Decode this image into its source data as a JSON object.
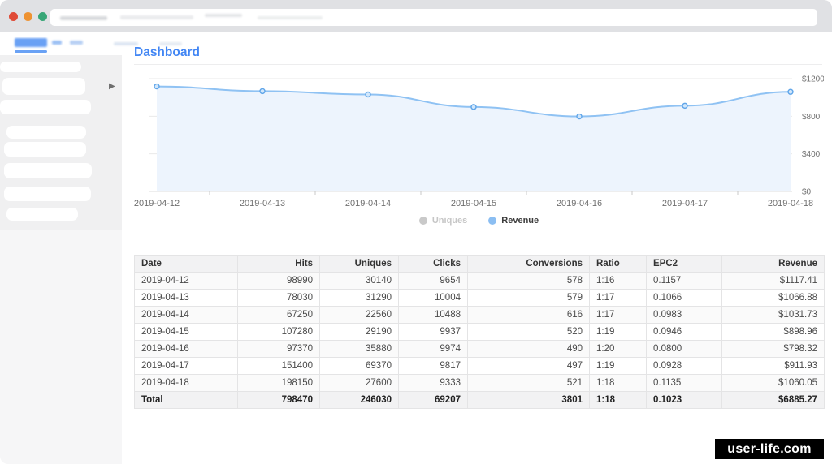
{
  "page": {
    "title": "Dashboard",
    "watermark": "user-life.com"
  },
  "browser": {
    "buttons": [
      "close",
      "minimize",
      "zoom"
    ],
    "url_text": "(redacted)"
  },
  "sidebar": {
    "items_redacted": 8,
    "expander_icon": "chevron-right-icon"
  },
  "colors": {
    "accent_blue": "#4286f4",
    "chart_line": "#8fc2f3",
    "chart_fill": "#edf4fd",
    "chart_point": "#5fa5e9"
  },
  "chart_data": {
    "type": "area",
    "title": "",
    "x": [
      "2019-04-12",
      "2019-04-13",
      "2019-04-14",
      "2019-04-15",
      "2019-04-16",
      "2019-04-17",
      "2019-04-18"
    ],
    "series": [
      {
        "name": "Revenue",
        "values": [
          1117.41,
          1066.88,
          1031.73,
          898.96,
          798.32,
          911.93,
          1060.05
        ]
      }
    ],
    "ylim": [
      0,
      1200
    ],
    "ytick_values": [
      0,
      400,
      800,
      1200
    ],
    "yticks": [
      "$0",
      "$400",
      "$800",
      "$1200"
    ],
    "legend_position": "bottom",
    "grid": true,
    "legend": [
      {
        "label": "Uniques",
        "color": "#c9c9c9",
        "active": false
      },
      {
        "label": "Revenue",
        "color": "#8bbef2",
        "active": true
      }
    ]
  },
  "table": {
    "columns": [
      {
        "label": "Date",
        "align": "left",
        "width": 127
      },
      {
        "label": "Hits",
        "align": "right",
        "width": 101
      },
      {
        "label": "Uniques",
        "align": "right",
        "width": 97
      },
      {
        "label": "Clicks",
        "align": "right",
        "width": 85
      },
      {
        "label": "Conversions",
        "align": "right",
        "width": 150
      },
      {
        "label": "Ratio",
        "align": "left",
        "width": 70
      },
      {
        "label": "EPC2",
        "align": "left",
        "width": 93
      },
      {
        "label": "Revenue",
        "align": "right",
        "width": 126
      }
    ],
    "rows": [
      [
        "2019-04-12",
        "98990",
        "30140",
        "9654",
        "578",
        "1:16",
        "0.1157",
        "$1117.41"
      ],
      [
        "2019-04-13",
        "78030",
        "31290",
        "10004",
        "579",
        "1:17",
        "0.1066",
        "$1066.88"
      ],
      [
        "2019-04-14",
        "67250",
        "22560",
        "10488",
        "616",
        "1:17",
        "0.0983",
        "$1031.73"
      ],
      [
        "2019-04-15",
        "107280",
        "29190",
        "9937",
        "520",
        "1:19",
        "0.0946",
        "$898.96"
      ],
      [
        "2019-04-16",
        "97370",
        "35880",
        "9974",
        "490",
        "1:20",
        "0.0800",
        "$798.32"
      ],
      [
        "2019-04-17",
        "151400",
        "69370",
        "9817",
        "497",
        "1:19",
        "0.0928",
        "$911.93"
      ],
      [
        "2019-04-18",
        "198150",
        "27600",
        "9333",
        "521",
        "1:18",
        "0.1135",
        "$1060.05"
      ]
    ],
    "total": [
      "Total",
      "798470",
      "246030",
      "69207",
      "3801",
      "1:18",
      "0.1023",
      "$6885.27"
    ]
  }
}
